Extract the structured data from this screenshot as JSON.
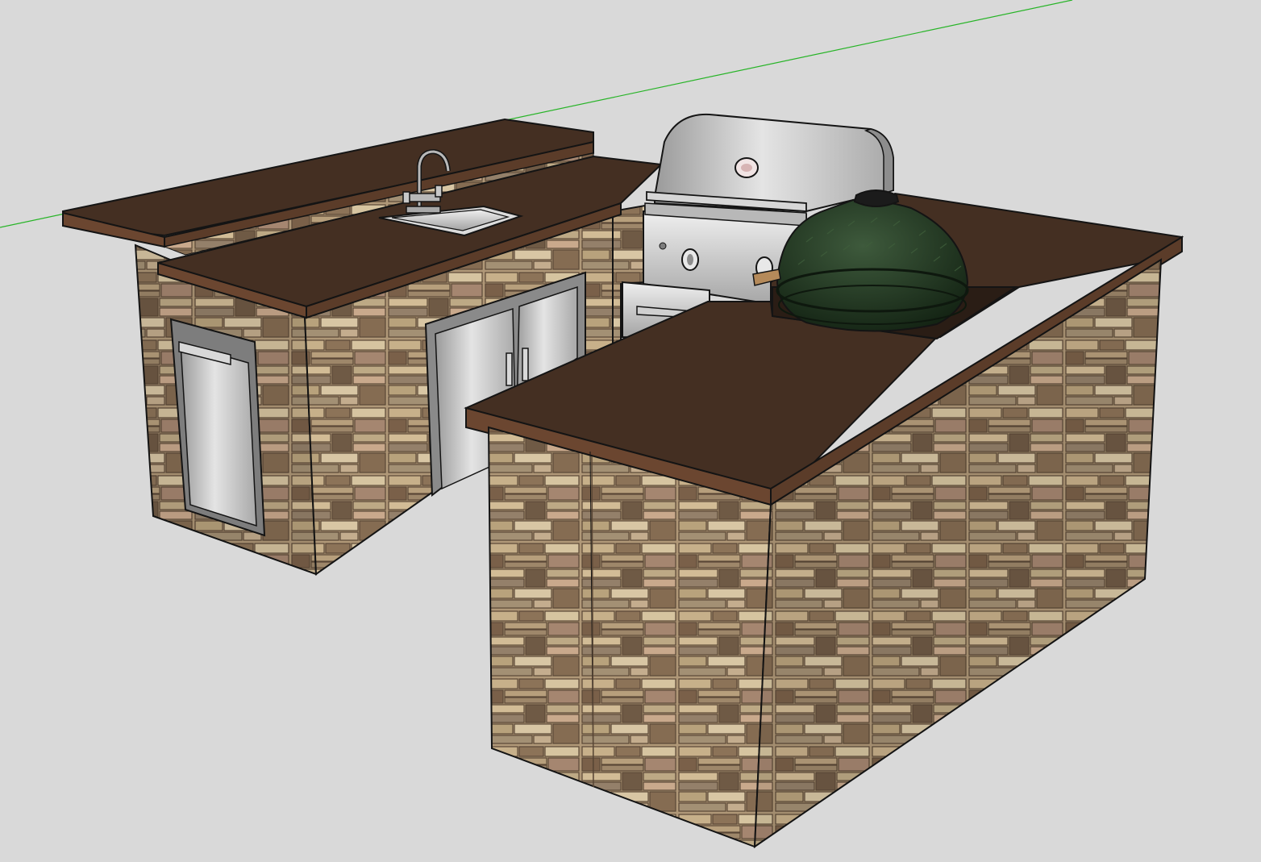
{
  "scene": {
    "background_color": "#d9d9d9",
    "axis_colors": {
      "green_axis": "#27b427"
    },
    "materials": {
      "countertop_top": "#442f22",
      "countertop_edge": "#6b4630",
      "stone_base": "#b09878",
      "stone_dark": "#6f5a45",
      "stone_light": "#d8c6a4",
      "stainless": "#c9c9c9",
      "stainless_dark": "#8d8d8d",
      "kamado_green": "#1f3320",
      "outline": "#141414"
    },
    "objects": [
      {
        "name": "raised-bar-counter",
        "material": "countertop"
      },
      {
        "name": "sink-counter",
        "material": "countertop"
      },
      {
        "name": "bar-sink",
        "material": "stainless"
      },
      {
        "name": "gooseneck-faucet",
        "material": "stainless"
      },
      {
        "name": "trash-drawer-door",
        "material": "stainless"
      },
      {
        "name": "double-access-doors",
        "material": "stainless"
      },
      {
        "name": "built-in-gas-grill",
        "material": "stainless"
      },
      {
        "name": "kamado-grill",
        "material": "kamado_green"
      },
      {
        "name": "l-shaped-counter",
        "material": "countertop"
      },
      {
        "name": "stone-veneer-island",
        "material": "stone"
      }
    ]
  }
}
